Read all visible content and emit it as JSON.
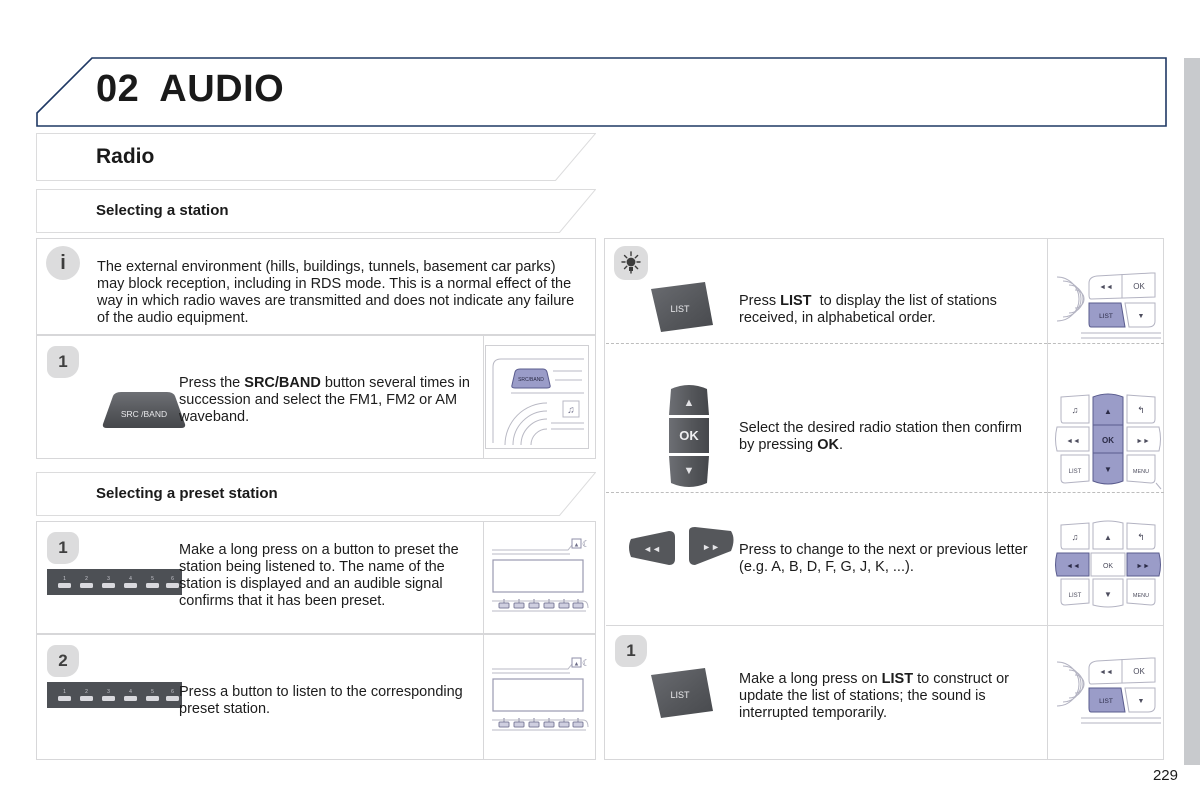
{
  "header": {
    "chapter_number": "02",
    "chapter_title": "AUDIO",
    "accent_color": "#1f3864"
  },
  "page_number": "229",
  "sections": {
    "radio": {
      "title": "Radio"
    },
    "selecting_a_station": {
      "title": "Selecting a station"
    },
    "selecting_a_preset_station": {
      "title": "Selecting a preset station"
    }
  },
  "left_column": {
    "info_note": {
      "icon": "info-icon",
      "glyph": "i",
      "text": "The external environment (hills, buildings, tunnels, basement car parks) may block reception, including in RDS mode. This is a normal effect of the way in which radio waves are transmitted and does not indicate any failure of the audio equipment."
    },
    "station_steps": [
      {
        "number": "1",
        "button_label": "SRC /BAND",
        "text_parts": [
          {
            "t": "Press the ",
            "bold": false
          },
          {
            "t": "SRC/BAND",
            "bold": true
          },
          {
            "t": " button several times in succession and select the FM1, FM2 or AM waveband.",
            "bold": false
          }
        ],
        "illustration": "head-unit-src-band"
      }
    ],
    "preset_steps": [
      {
        "number": "1",
        "button_label": "preset-keys-1-6",
        "preset_keys": [
          "1",
          "2",
          "3",
          "4",
          "5",
          "6"
        ],
        "text_parts": [
          {
            "t": "Make a long press on a button to preset the station being listened to. The name of the station is displayed and an audible signal confirms that it has been preset.",
            "bold": false
          }
        ],
        "illustration": "head-unit-display-presets"
      },
      {
        "number": "2",
        "button_label": "preset-keys-1-6",
        "preset_keys": [
          "1",
          "2",
          "3",
          "4",
          "5",
          "6"
        ],
        "text_parts": [
          {
            "t": "Press a button to listen to the corresponding preset station.",
            "bold": false
          }
        ],
        "illustration": "head-unit-display-presets"
      }
    ]
  },
  "right_column": {
    "tip_note": {
      "icon": "lightbulb-icon"
    },
    "rows": [
      {
        "badge": null,
        "button_label": "LIST",
        "text_parts": [
          {
            "t": "Press ",
            "bold": false
          },
          {
            "t": "LIST",
            "bold": true
          },
          {
            "t": "  to display the list of stations received, in alphabetical order.",
            "bold": false
          }
        ],
        "illustration": "steering-wheel-list-highlight",
        "wheel_labels": {
          "rew": "◄◄",
          "ok": "OK",
          "list": "LIST",
          "down": "▼"
        }
      },
      {
        "badge": null,
        "button_label": "OK",
        "button_up": "▲",
        "button_down": "▼",
        "text_parts": [
          {
            "t": "Select the desired radio station then confirm by pressing ",
            "bold": false
          },
          {
            "t": "OK",
            "bold": true
          },
          {
            "t": ".",
            "bold": false
          }
        ],
        "illustration": "steering-wheel-ok-highlight",
        "wheel_labels": {
          "source": "♫",
          "up": "▲",
          "back": "↰",
          "rew": "◄◄",
          "ok": "OK",
          "ff": "►►",
          "list": "LIST",
          "down": "▼",
          "menu": "MENU"
        }
      },
      {
        "badge": null,
        "button_label_rew": "◄◄",
        "button_label_ff": "►►",
        "text_parts": [
          {
            "t": "Press to change to the next or previous letter (e.g. A, B, D, F, G, J, K, ...).",
            "bold": false
          }
        ],
        "illustration": "steering-wheel-rew-ff-highlight",
        "wheel_labels": {
          "source": "♫",
          "up": "▲",
          "back": "↰",
          "rew": "◄◄",
          "ok": "OK",
          "ff": "►►",
          "list": "LIST",
          "down": "▼",
          "menu": "MENU"
        }
      },
      {
        "badge": "1",
        "button_label": "LIST",
        "text_parts": [
          {
            "t": "Make a long press on ",
            "bold": false
          },
          {
            "t": "LIST",
            "bold": true
          },
          {
            "t": " to construct or update the list of stations; the sound is interrupted temporarily.",
            "bold": false
          }
        ],
        "illustration": "steering-wheel-list-highlight",
        "wheel_labels": {
          "rew": "◄◄",
          "ok": "OK",
          "list": "LIST",
          "down": "▼"
        }
      }
    ]
  },
  "colors": {
    "highlight_blue": "#9a9cc8",
    "button_dark": "#56585c",
    "panel_border": "#d7d7d9",
    "badge_gray": "#dcdcdd"
  }
}
